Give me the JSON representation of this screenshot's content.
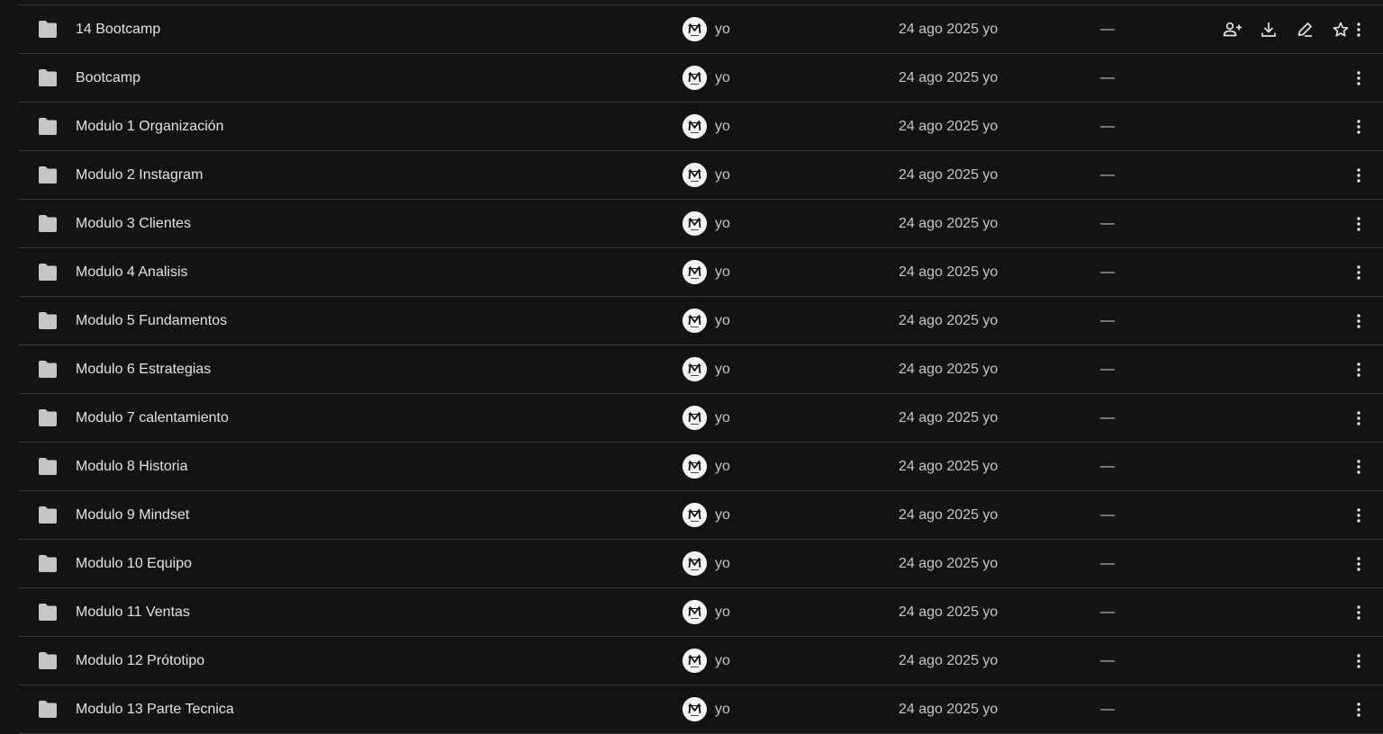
{
  "files": [
    {
      "name": "14 Bootcamp",
      "owner": "yo",
      "modified": "24 ago 2025 yo",
      "size": "—",
      "hovered": true
    },
    {
      "name": "Bootcamp",
      "owner": "yo",
      "modified": "24 ago 2025 yo",
      "size": "—"
    },
    {
      "name": "Modulo 1 Organización",
      "owner": "yo",
      "modified": "24 ago 2025 yo",
      "size": "—"
    },
    {
      "name": "Modulo 2 Instagram",
      "owner": "yo",
      "modified": "24 ago 2025 yo",
      "size": "—"
    },
    {
      "name": "Modulo 3 Clientes",
      "owner": "yo",
      "modified": "24 ago 2025 yo",
      "size": "—"
    },
    {
      "name": "Modulo 4 Analisis",
      "owner": "yo",
      "modified": "24 ago 2025 yo",
      "size": "—"
    },
    {
      "name": "Modulo 5 Fundamentos",
      "owner": "yo",
      "modified": "24 ago 2025 yo",
      "size": "—"
    },
    {
      "name": "Modulo 6 Estrategias",
      "owner": "yo",
      "modified": "24 ago 2025 yo",
      "size": "—"
    },
    {
      "name": "Modulo 7 calentamiento",
      "owner": "yo",
      "modified": "24 ago 2025 yo",
      "size": "—"
    },
    {
      "name": "Modulo 8 Historia",
      "owner": "yo",
      "modified": "24 ago 2025 yo",
      "size": "—"
    },
    {
      "name": "Modulo 9 Mindset",
      "owner": "yo",
      "modified": "24 ago 2025 yo",
      "size": "—"
    },
    {
      "name": "Modulo 10 Equipo",
      "owner": "yo",
      "modified": "24 ago 2025 yo",
      "size": "—"
    },
    {
      "name": "Modulo 11 Ventas",
      "owner": "yo",
      "modified": "24 ago 2025 yo",
      "size": "—"
    },
    {
      "name": "Modulo 12 Prótotipo",
      "owner": "yo",
      "modified": "24 ago 2025 yo",
      "size": "—"
    },
    {
      "name": "Modulo 13 Parte Tecnica",
      "owner": "yo",
      "modified": "24 ago 2025 yo",
      "size": "—"
    }
  ],
  "hover_actions": [
    "share-icon",
    "download-icon",
    "rename-icon",
    "star-icon"
  ],
  "icons": {
    "folder": "folder-icon",
    "avatar": "avatar",
    "more": "more-vert-icon"
  },
  "colors": {
    "background": "#131313",
    "divider": "#3b3b3b",
    "text": "#e3e3e3",
    "secondary_text": "#c4c7c5",
    "folder": "#c4c7c5",
    "avatar_bg": "#f5f5f5"
  }
}
